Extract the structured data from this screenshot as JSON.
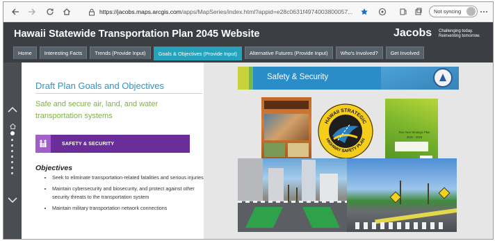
{
  "browser": {
    "url_host": "https://jacobs.maps.arcgis.com",
    "url_rest": "/apps/MapSeries/index.html?appid=e28c0631f4974003800057...",
    "sync_label": "Not syncing"
  },
  "site": {
    "title": "Hawaii Statewide Transportation Plan 2045 Website",
    "brand": "Jacobs",
    "tagline": "Challenging today. Reinventing tomorrow.",
    "tabs": [
      "Home",
      "Interesting Facts",
      "Trends (Provide Input)",
      "Goals & Objectives (Provide Input)",
      "Alternative Futures (Provide Input)",
      "Who's Involved?",
      "Get Involved"
    ],
    "active_tab": 3
  },
  "panel": {
    "title": "Draft Plan Goals and Objectives",
    "subtitle": "Safe and secure air, land, and water transportation systems",
    "banner": "SAFETY & SECURITY",
    "objectives_heading": "Objectives",
    "objectives": [
      "Seek to eliminate transportation-related fatalities and serious injuries",
      "Maintain cybersecurity and biosecurity, and protect against other security threats to the transportation system",
      "Maintain military transportation network connections"
    ]
  },
  "slide": {
    "banner_title": "Safety & Security",
    "seal_text_top": "HAWAII STRATEGIC",
    "seal_text_bottom": "HIGHWAY SAFETY PLAN",
    "doc2_title": "Five Year Strategic Plan",
    "doc2_years": "2021 - 2025"
  },
  "colors": {
    "header_bg": "#3b3f43",
    "tab_active": "#26a2bd",
    "title_blue": "#2f94c5",
    "subtitle_green": "#7cb33d",
    "banner_purple": "#6a2d99"
  },
  "icons": {
    "back": "back-arrow-icon",
    "forward": "forward-arrow-icon",
    "reload": "reload-icon",
    "home": "home-icon",
    "lock": "lock-icon",
    "favorite": "star-icon",
    "extensions": "puzzle-icon",
    "collections": "collections-icon",
    "menu": "more-icon",
    "nav_up": "chevron-up-icon",
    "nav_down": "chevron-down-icon"
  }
}
